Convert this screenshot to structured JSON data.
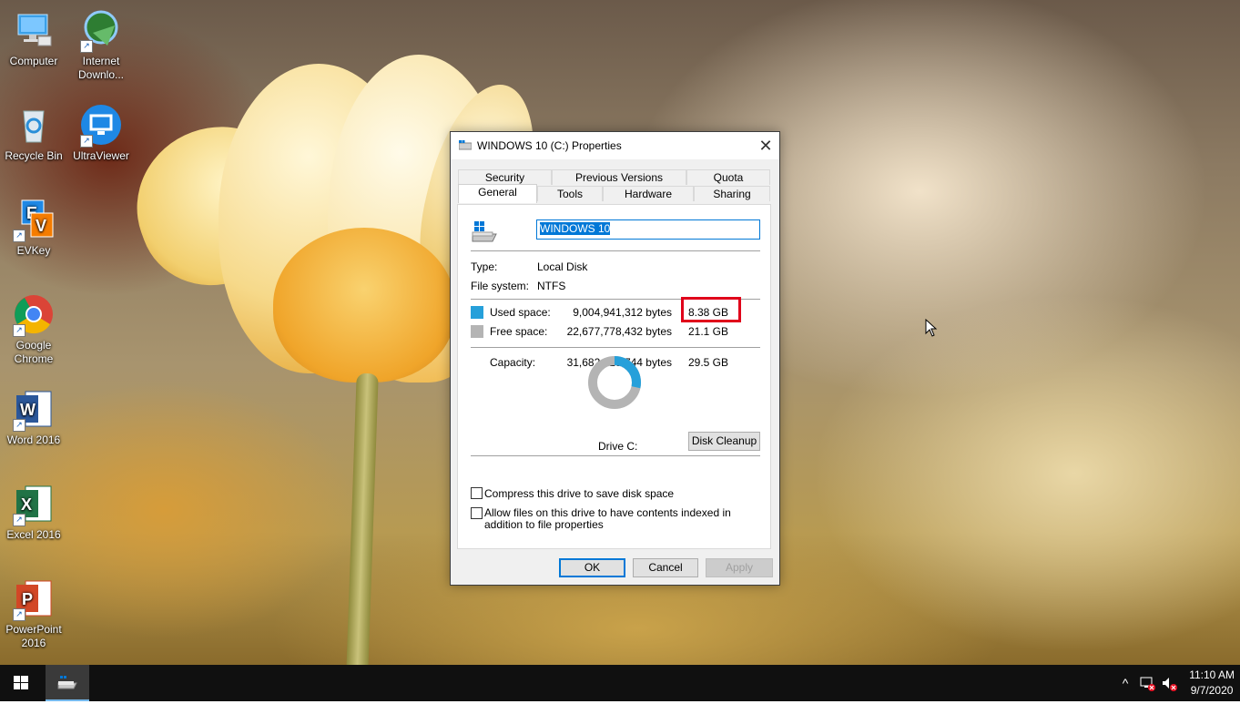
{
  "desktop": {
    "icons": [
      {
        "label": "Computer",
        "icon": "computer-icon"
      },
      {
        "label": "Internet Downlo...",
        "icon": "internet-download-manager-icon"
      },
      {
        "label": "Recycle Bin",
        "icon": "recycle-bin-icon"
      },
      {
        "label": "UltraViewer",
        "icon": "ultraviewer-icon"
      },
      {
        "label": "EVKey",
        "icon": "evkey-icon"
      },
      {
        "label": "Google Chrome",
        "icon": "chrome-icon"
      },
      {
        "label": "Word 2016",
        "icon": "word-icon"
      },
      {
        "label": "Excel 2016",
        "icon": "excel-icon"
      },
      {
        "label": "PowerPoint 2016",
        "icon": "powerpoint-icon"
      }
    ]
  },
  "dialog": {
    "title": "WINDOWS 10 (C:) Properties",
    "tabs_back": [
      "Security",
      "Previous Versions",
      "Quota"
    ],
    "tabs_front": [
      "General",
      "Tools",
      "Hardware",
      "Sharing"
    ],
    "active_tab": "General",
    "volume_name": "WINDOWS 10",
    "type_label": "Type:",
    "type_value": "Local Disk",
    "fs_label": "File system:",
    "fs_value": "NTFS",
    "used_label": "Used space:",
    "used_bytes": "9,004,941,312 bytes",
    "used_gb": "8.38 GB",
    "free_label": "Free space:",
    "free_bytes": "22,677,778,432 bytes",
    "free_gb": "21.1 GB",
    "capacity_label": "Capacity:",
    "capacity_bytes": "31,682,719,744 bytes",
    "capacity_gb": "29.5 GB",
    "used_fraction": 0.284,
    "drive_label": "Drive C:",
    "disk_cleanup": "Disk Cleanup",
    "compress_label": "Compress this drive to save disk space",
    "index_label": "Allow files on this drive to have contents indexed in addition to file properties",
    "ok": "OK",
    "cancel": "Cancel",
    "apply": "Apply",
    "used_color": "#26a0da",
    "free_color": "#b4b4b4"
  },
  "taskbar": {
    "time": "11:10 AM",
    "date": "9/7/2020"
  }
}
